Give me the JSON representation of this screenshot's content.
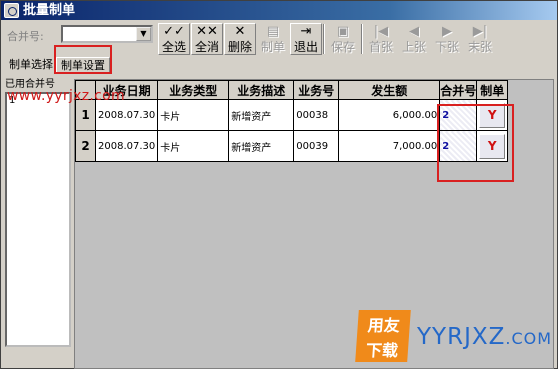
{
  "window": {
    "title": "批量制单"
  },
  "toolbar": {
    "merge_label": "合并号:",
    "merge_value": "",
    "buttons": [
      {
        "id": "select-all",
        "label": "全选",
        "icon": "✓✓",
        "enabled": true
      },
      {
        "id": "clear-all",
        "label": "全消",
        "icon": "✕✕",
        "enabled": true
      },
      {
        "id": "delete",
        "label": "删除",
        "icon": "✕",
        "enabled": true
      },
      {
        "id": "make",
        "label": "制单",
        "icon": "▤",
        "enabled": false
      },
      {
        "id": "exit",
        "label": "退出",
        "icon": "⇥",
        "enabled": true
      },
      {
        "id": "save",
        "label": "保存",
        "icon": "▣",
        "enabled": false
      },
      {
        "id": "first",
        "label": "首张",
        "icon": "|◀",
        "enabled": false
      },
      {
        "id": "prev",
        "label": "上张",
        "icon": "◀",
        "enabled": false
      },
      {
        "id": "next",
        "label": "下张",
        "icon": "▶",
        "enabled": false
      },
      {
        "id": "last",
        "label": "末张",
        "icon": "▶|",
        "enabled": false
      }
    ]
  },
  "tabs": [
    {
      "label": "制单选择",
      "active": false
    },
    {
      "label": "制单设置",
      "active": true
    }
  ],
  "left_panel": {
    "label": "已用合并号",
    "items": [
      "1"
    ]
  },
  "grid": {
    "headers": [
      "",
      "业务日期",
      "业务类型",
      "业务描述",
      "业务号",
      "发生额",
      "合并号",
      "制单"
    ],
    "rows": [
      {
        "row": "1",
        "date": "2008.07.30",
        "type": "卡片",
        "desc": "新增资产",
        "no": "00038",
        "amount": "6,000.00",
        "merge": "2",
        "make": "Y"
      },
      {
        "row": "2",
        "date": "2008.07.30",
        "type": "卡片",
        "desc": "新增资产",
        "no": "00039",
        "amount": "7,000.00",
        "merge": "2",
        "make": "Y"
      }
    ]
  },
  "watermarks": {
    "top": "www.yyrjxz.com",
    "logo_top": "用友",
    "logo_bottom": "下载",
    "site": "YYRJXZ",
    "site_suffix": ".COM"
  },
  "colors": {
    "annotation": "#d92020",
    "titlebar": "#0a246a",
    "y_mark": "#d01010"
  }
}
